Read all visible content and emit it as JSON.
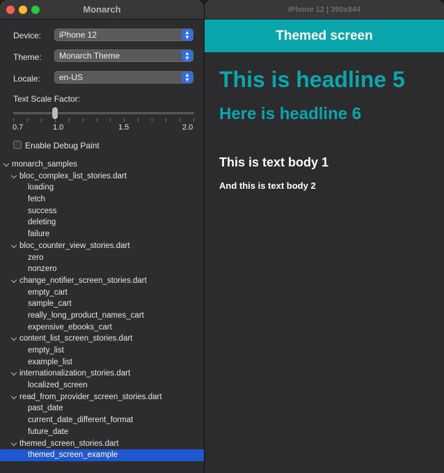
{
  "left_window": {
    "title": "Monarch",
    "device": {
      "label": "Device:",
      "value": "iPhone 12"
    },
    "theme": {
      "label": "Theme:",
      "value": "Monarch Theme"
    },
    "locale": {
      "label": "Locale:",
      "value": "en-US"
    },
    "text_scale": {
      "label": "Text Scale Factor:",
      "ticks": [
        "0.7",
        "1.0",
        "1.5",
        "2.0"
      ],
      "min": 0.7,
      "max": 2.0,
      "value": 1.0
    },
    "debug_paint": {
      "label": "Enable Debug Paint",
      "checked": false
    },
    "tree": [
      {
        "label": "monarch_samples",
        "level": 0,
        "expanded": true
      },
      {
        "label": "bloc_complex_list_stories.dart",
        "level": 1,
        "expanded": true
      },
      {
        "label": "loading",
        "level": 2
      },
      {
        "label": "fetch",
        "level": 2
      },
      {
        "label": "success",
        "level": 2
      },
      {
        "label": "deleting",
        "level": 2
      },
      {
        "label": "failure",
        "level": 2
      },
      {
        "label": "bloc_counter_view_stories.dart",
        "level": 1,
        "expanded": true
      },
      {
        "label": "zero",
        "level": 2
      },
      {
        "label": "nonzero",
        "level": 2
      },
      {
        "label": "change_notifier_screen_stories.dart",
        "level": 1,
        "expanded": true
      },
      {
        "label": "empty_cart",
        "level": 2
      },
      {
        "label": "sample_cart",
        "level": 2
      },
      {
        "label": "really_long_product_names_cart",
        "level": 2
      },
      {
        "label": "expensive_ebooks_cart",
        "level": 2
      },
      {
        "label": "content_list_screen_stories.dart",
        "level": 1,
        "expanded": true
      },
      {
        "label": "empty_list",
        "level": 2
      },
      {
        "label": "example_list",
        "level": 2
      },
      {
        "label": "internationalization_stories.dart",
        "level": 1,
        "expanded": true
      },
      {
        "label": "localized_screen",
        "level": 2
      },
      {
        "label": "read_from_provider_screen_stories.dart",
        "level": 1,
        "expanded": true
      },
      {
        "label": "past_date",
        "level": 2
      },
      {
        "label": "current_date_different_format",
        "level": 2
      },
      {
        "label": "future_date",
        "level": 2
      },
      {
        "label": "themed_screen_stories.dart",
        "level": 1,
        "expanded": true
      },
      {
        "label": "themed_screen_example",
        "level": 2,
        "selected": true
      }
    ]
  },
  "right_window": {
    "title": "iPhone 12 | 390x844",
    "app_bar_title": "Themed screen",
    "headline5": "This is headline 5",
    "headline6": "Here is headline 6",
    "body1": "This is text body 1",
    "body2": "And this is text body 2",
    "accent_color": "#0aa6ab"
  }
}
